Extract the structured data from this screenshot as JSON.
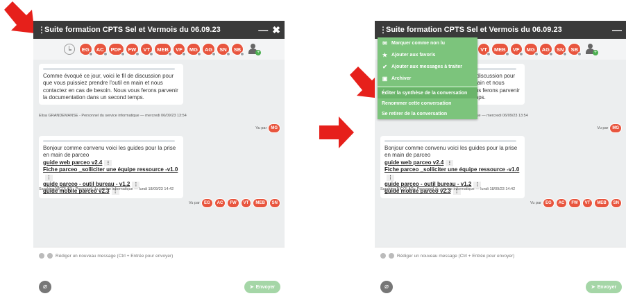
{
  "chat": {
    "title": "Suite formation CPTS Sel et Vermois du 06.09.23",
    "minimize_symbol": "—",
    "close_symbol": "✖",
    "kebab_symbol": "⋮",
    "members": [
      "EG",
      "AC",
      "PDF",
      "FW",
      "VT",
      "MEB",
      "VF",
      "MG",
      "AG",
      "SN",
      "SB"
    ],
    "messages": [
      {
        "text": "Comme évoqué ce jour, voici le fil de discussion pour que vous puissiez prendre l'outil en main et nous contactez en cas de besoin. Nous vous ferons parvenir la documentation dans un second temps.",
        "meta": "Elisa GRANDEMANSE - Personnel du service informatique  —  mercredi 06/09/23 13:54",
        "seen_label": "Vu par",
        "seen_by": [
          "MG"
        ]
      },
      {
        "text": "Bonjour comme convenu voici les guides pour la prise en main de parceo",
        "links": [
          "guide web parceo v2.4",
          "Fiche parceo _solliciter une équipe ressource -v1.0",
          "guide parceo - outil bureau - v1.2",
          "guide mobile parceo v2.3"
        ],
        "meta": "Sandrine NICOLAS - Personnel du service informatique  —  lundi 18/09/23 14:42",
        "seen_label": "Vu par",
        "seen_by": [
          "EG",
          "AC",
          "FW",
          "VT",
          "MEB",
          "SN"
        ]
      }
    ],
    "composer_placeholder": "Rédiger un nouveau message (Ctrl + Entrée pour envoyer)",
    "send_label": "Envoyer"
  },
  "context_menu": {
    "items": [
      {
        "label": "Marquer comme non lu",
        "icon": "envelope-icon"
      },
      {
        "label": "Ajouter aux favoris",
        "icon": "star-icon"
      },
      {
        "label": "Ajouter aux messages à traiter",
        "icon": "check-icon"
      },
      {
        "label": "Archiver",
        "icon": "archive-icon"
      },
      {
        "label": "Éditer la synthèse de la conversation",
        "icon": ""
      },
      {
        "label": "Renommer cette conversation",
        "icon": ""
      },
      {
        "label": "Se retirer de la conversation",
        "icon": ""
      }
    ]
  },
  "colors": {
    "avatar": "#e8553e",
    "titlebar": "#3a3a3a",
    "menu": "#7cc47c",
    "arrow": "#e6201b"
  }
}
